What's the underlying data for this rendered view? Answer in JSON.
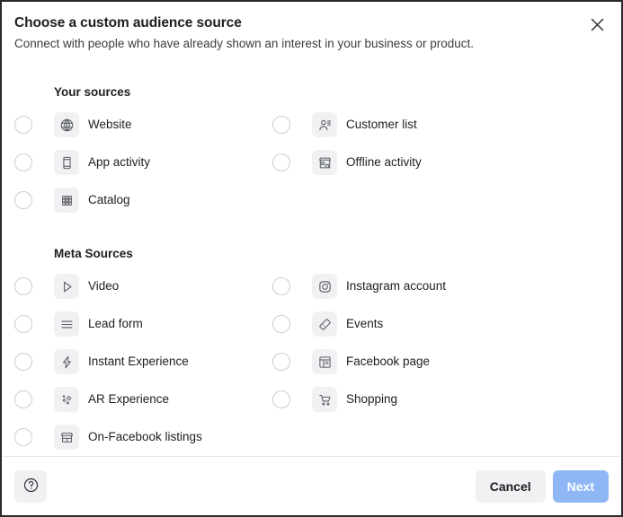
{
  "dialog": {
    "title": "Choose a custom audience source",
    "subtitle": "Connect with people who have already shown an interest in your business or product.",
    "close_icon": "close-icon"
  },
  "sections": [
    {
      "id": "your-sources",
      "title": "Your sources",
      "left": [
        {
          "label": "Website",
          "icon": "globe-icon",
          "selected": false
        },
        {
          "label": "App activity",
          "icon": "mobile-phone-icon",
          "selected": false
        },
        {
          "label": "Catalog",
          "icon": "grid-dots-icon",
          "selected": false
        }
      ],
      "right": [
        {
          "label": "Customer list",
          "icon": "person-list-icon",
          "selected": false
        },
        {
          "label": "Offline activity",
          "icon": "storefront-icon",
          "selected": false
        }
      ]
    },
    {
      "id": "meta-sources",
      "title": "Meta Sources",
      "left": [
        {
          "label": "Video",
          "icon": "play-triangle-icon",
          "selected": false
        },
        {
          "label": "Lead form",
          "icon": "form-lines-icon",
          "selected": false
        },
        {
          "label": "Instant Experience",
          "icon": "lightning-bolt-icon",
          "selected": false
        },
        {
          "label": "AR Experience",
          "icon": "sparkles-icon",
          "selected": false
        },
        {
          "label": "On-Facebook listings",
          "icon": "shop-awning-icon",
          "selected": false
        }
      ],
      "right": [
        {
          "label": "Instagram account",
          "icon": "instagram-camera-icon",
          "selected": false
        },
        {
          "label": "Events",
          "icon": "ticket-icon",
          "selected": false
        },
        {
          "label": "Facebook page",
          "icon": "page-layout-icon",
          "selected": false
        },
        {
          "label": "Shopping",
          "icon": "shopping-cart-icon",
          "selected": false
        }
      ]
    }
  ],
  "footer": {
    "help_icon": "help-circle-icon",
    "cancel_label": "Cancel",
    "next_label": "Next",
    "next_disabled": true
  },
  "colors": {
    "primary_disabled": "#8fb7f5",
    "tile_bg": "#f0f1f3",
    "text": "#1c1e21",
    "radio_border": "#cbced3",
    "dialog_border": "#2a2a2a"
  }
}
